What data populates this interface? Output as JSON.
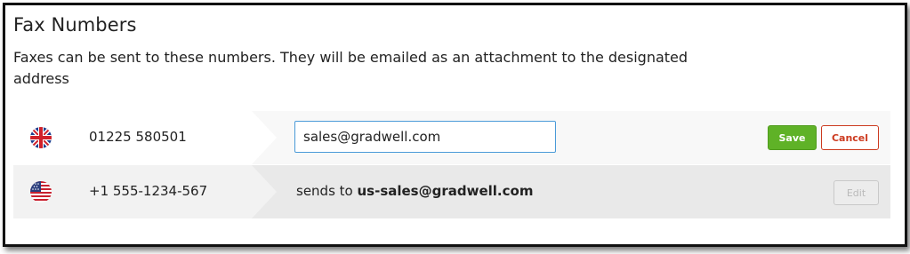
{
  "section": {
    "title": "Fax Numbers",
    "description": "Faxes can be sent to these numbers. They will be emailed as an attachment to the designated address"
  },
  "rows": [
    {
      "flag": "uk-flag-icon",
      "number": "01225 580501",
      "email_value": "sales@gradwell.com",
      "save_label": "Save",
      "cancel_label": "Cancel"
    },
    {
      "flag": "us-flag-icon",
      "number": "+1 555-1234-567",
      "sends_prefix": "sends to",
      "sends_email": "us-sales@gradwell.com",
      "edit_label": "Edit"
    }
  ],
  "colors": {
    "save": "#5fb227",
    "cancel": "#cc3a1f",
    "input_border": "#4a9ad8"
  }
}
